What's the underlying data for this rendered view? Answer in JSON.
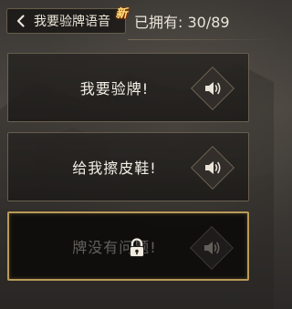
{
  "header": {
    "back_label": "我要验牌语音",
    "new_badge": "新",
    "owned_text": "已拥有: 30/89"
  },
  "voice_lines": [
    {
      "label": "我要验牌!",
      "locked": false,
      "icon": "speaker-icon"
    },
    {
      "label": "给我擦皮鞋!",
      "locked": false,
      "icon": "speaker-icon"
    },
    {
      "label": "牌没有问题!",
      "locked": true,
      "icon": "speaker-icon",
      "overlay_icon": "lock-icon"
    }
  ],
  "colors": {
    "text": "#f3efe6",
    "border": "#a0917a",
    "selected_border": "#b99a57",
    "badge": "#ffe07a"
  }
}
